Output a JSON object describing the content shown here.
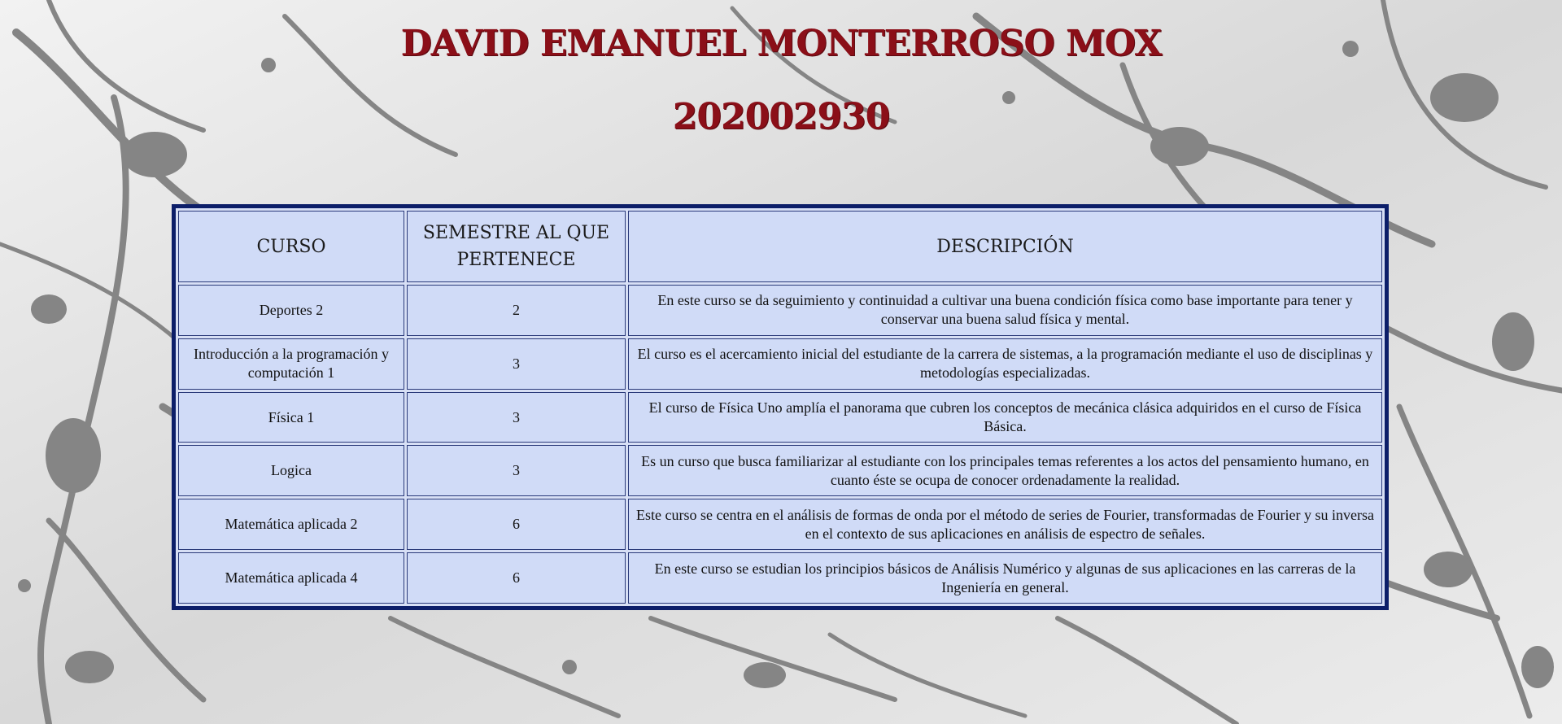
{
  "header": {
    "name": "DAVID EMANUEL MONTERROSO MOX",
    "student_id": "202002930"
  },
  "table": {
    "headers": {
      "course": "CURSO",
      "semester": "SEMESTRE AL QUE PERTENECE",
      "description": "DESCRIPCIÓN"
    },
    "rows": [
      {
        "course": "Deportes 2",
        "semester": "2",
        "description": "En este curso se da seguimiento y continuidad a cultivar una buena condición física como base importante para tener y conservar una buena salud física y mental."
      },
      {
        "course": "Introducción a la programación y computación 1",
        "semester": "3",
        "description": "El curso es el acercamiento inicial del estudiante de la carrera de sistemas, a la programación mediante el uso de disciplinas y metodologías especializadas."
      },
      {
        "course": "Física 1",
        "semester": "3",
        "description": "El curso de Física Uno amplía el panorama que cubren los conceptos de mecánica clásica adquiridos en el curso de Física Básica."
      },
      {
        "course": "Logica",
        "semester": "3",
        "description": "Es un curso que busca familiarizar al estudiante con los principales temas referentes a los actos del pensamiento humano, en cuanto éste se ocupa de conocer ordenadamente la realidad."
      },
      {
        "course": "Matemática aplicada 2",
        "semester": "6",
        "description": "Este curso se centra en el análisis de formas de onda por el método de series de Fourier, transformadas de Fourier y su inversa en el contexto de sus aplicaciones en análisis de espectro de señales."
      },
      {
        "course": "Matemática aplicada 4",
        "semester": "6",
        "description": "En este curso se estudian los principios básicos de Análisis Numérico y algunas de sus aplicaciones en las carreras de la Ingeniería en general."
      }
    ]
  },
  "colors": {
    "heading": "#8b0f18",
    "table_border": "#0c1e69",
    "cell_background": "#d0dbf7",
    "background_splatter": "#7f7f7f"
  }
}
